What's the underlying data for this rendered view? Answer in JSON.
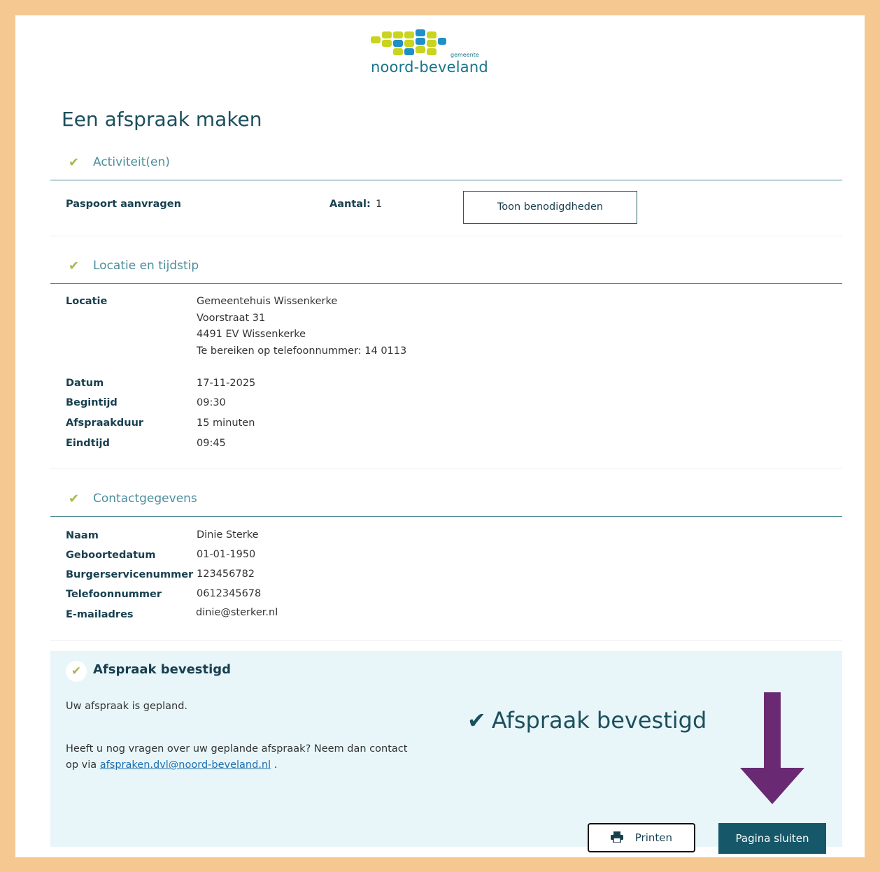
{
  "logo": {
    "name": "noord-beveland",
    "small": "gemeente"
  },
  "page_title": "Een afspraak maken",
  "sections": {
    "activity": {
      "title": "Activiteit(en)",
      "item_label": "Paspoort aanvragen",
      "count_label": "Aantal:",
      "count_value": "1",
      "requirements_button": "Toon benodigdheden"
    },
    "location_time": {
      "title": "Locatie en tijdstip",
      "location_label": "Locatie",
      "location_lines": [
        "Gemeentehuis Wissenkerke",
        "Voorstraat 31",
        "4491 EV Wissenkerke",
        "Te bereiken op telefoonnummer: 14 0113"
      ],
      "date_label": "Datum",
      "date_value": "17-11-2025",
      "start_label": "Begintijd",
      "start_value": "09:30",
      "duration_label": "Afspraakduur",
      "duration_value": "15 minuten",
      "end_label": "Eindtijd",
      "end_value": "09:45"
    },
    "contact": {
      "title": "Contactgegevens",
      "name_label": "Naam",
      "name_value": "Dinie Sterke",
      "birth_label": "Geboortedatum",
      "birth_value": "01-01-1950",
      "bsn_label": "Burgerservicenummer",
      "bsn_value": "123456782",
      "phone_label": "Telefoonnummer",
      "phone_value": "0612345678",
      "email_label": "E-mailadres",
      "email_value": "dinie@sterker.nl"
    }
  },
  "confirmation": {
    "title": "Afspraak bevestigd",
    "planned_text": "Uw afspraak is gepland.",
    "question_text_1": "Heeft u nog vragen over uw geplande afspraak? Neem dan contact",
    "question_text_2_prefix": "op via ",
    "question_link": "afspraken.dvl@noord-beveland.nl",
    "question_text_2_suffix": " .",
    "big_text": "Afspraak bevestigd",
    "print_button": "Printen",
    "close_button": "Pagina sluiten"
  },
  "colors": {
    "page_border": "#f6c891",
    "accent": "#16586a",
    "check": "#a9b84a",
    "panel": "#e8f6f9",
    "arrow": "#6a2a73"
  },
  "icons": {
    "section_check": "checkmark-icon",
    "print": "printer-icon",
    "annotation": "down-arrow-icon"
  }
}
